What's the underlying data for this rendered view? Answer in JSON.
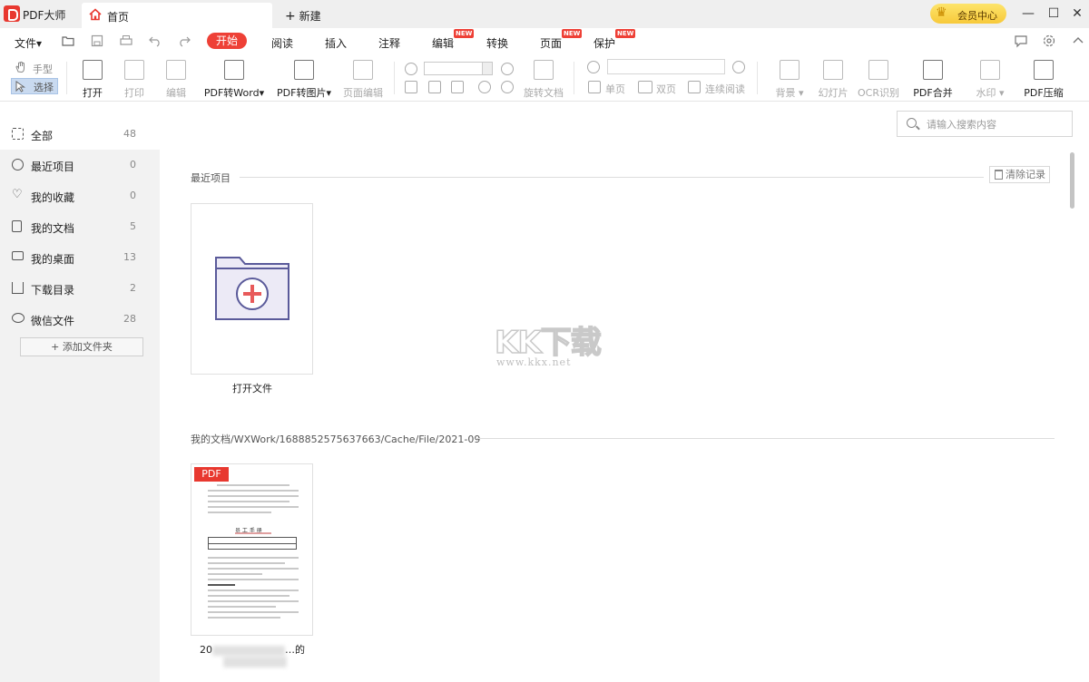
{
  "app": {
    "name": "PDF大师"
  },
  "tabs": {
    "home": "首页",
    "new": "新建"
  },
  "vip": {
    "label": "会员中心"
  },
  "menu": {
    "file": "文件▾",
    "items": [
      "开始",
      "阅读",
      "插入",
      "注释",
      "编辑",
      "转换",
      "页面",
      "保护"
    ],
    "new_badge": "NEW"
  },
  "toolbar": {
    "hand": "手型",
    "select": "选择",
    "open": "打开",
    "print": "打印",
    "edit": "编辑",
    "pdf_to_word": "PDF转Word▾",
    "pdf_to_image": "PDF转图片▾",
    "page_edit": "页面编辑",
    "rotate_doc": "旋转文档",
    "single": "单页",
    "double": "双页",
    "continuous": "连续阅读",
    "background": "背景 ▾",
    "slideshow": "幻灯片",
    "ocr": "OCR识别",
    "merge": "PDF合并",
    "watermark": "水印 ▾",
    "compress": "PDF压缩"
  },
  "sidebar": {
    "items": [
      {
        "label": "全部",
        "count": "48",
        "icon": "grid-icon"
      },
      {
        "label": "最近项目",
        "count": "0",
        "icon": "clock-icon"
      },
      {
        "label": "我的收藏",
        "count": "0",
        "icon": "heart-icon"
      },
      {
        "label": "我的文档",
        "count": "5",
        "icon": "document-icon"
      },
      {
        "label": "我的桌面",
        "count": "13",
        "icon": "monitor-icon"
      },
      {
        "label": "下载目录",
        "count": "2",
        "icon": "download-icon"
      },
      {
        "label": "微信文件",
        "count": "28",
        "icon": "wechat-icon"
      }
    ],
    "add_folder": "+ 添加文件夹"
  },
  "main": {
    "search_placeholder": "请输入搜索内容",
    "recent_title": "最近项目",
    "clear_records": "清除记录",
    "open_file": "打开文件",
    "path_title": "我的文档/WXWork/1688852575637663/Cache/File/2021-09",
    "pdf_tag": "PDF",
    "doc_title": "员 工 手 册",
    "file_name_line1": "20",
    "file_name_line1b": "…的",
    "file_name_line2": "员工手册"
  },
  "watermark": {
    "text": "KK下载",
    "url": "www.kkx.net"
  },
  "colors": {
    "accent": "#ee4036",
    "vip": "#f7c93a",
    "sidebar_bg": "#f2f2f2"
  }
}
